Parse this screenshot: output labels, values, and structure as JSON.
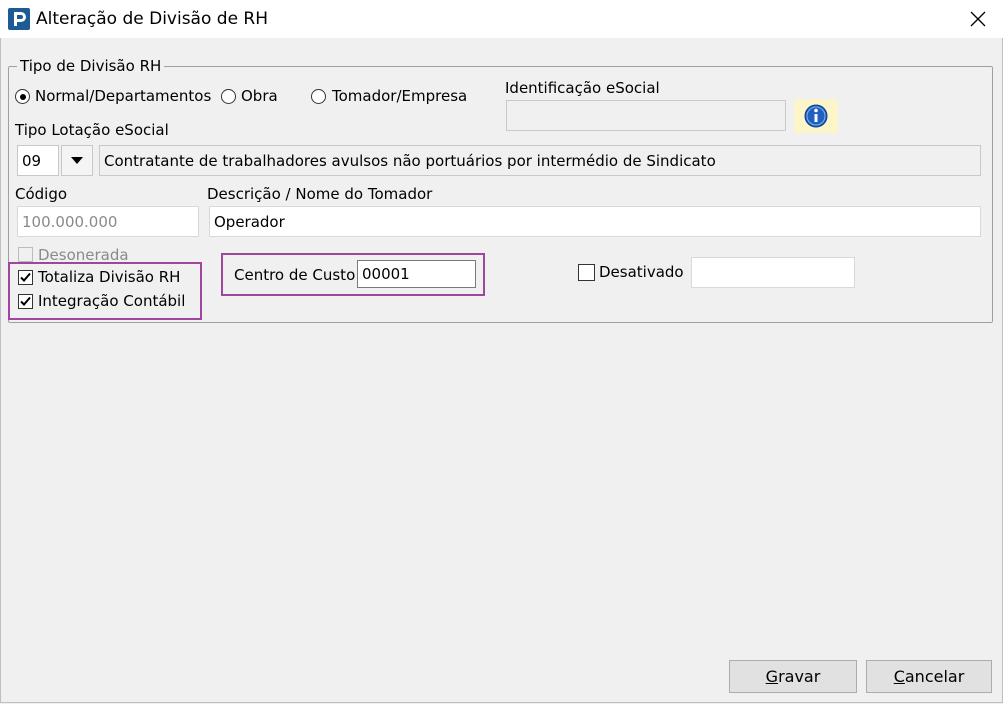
{
  "window": {
    "title": "Alteração de Divisão de RH"
  },
  "group": {
    "legend": "Tipo de Divisão RH",
    "radios": [
      {
        "label": "Normal/Departamentos",
        "checked": true
      },
      {
        "label": "Obra",
        "checked": false
      },
      {
        "label": "Tomador/Empresa",
        "checked": false
      }
    ]
  },
  "identificacao": {
    "label": "Identificação eSocial",
    "value": ""
  },
  "tipo_lotacao": {
    "label": "Tipo Lotação eSocial",
    "code": "09",
    "description": "Contratante de trabalhadores avulsos não portuários por intermédio de Sindicato"
  },
  "codigo": {
    "label": "Código",
    "value": "100.000.000"
  },
  "descricao": {
    "label": "Descrição / Nome do Tomador",
    "value": "Operador"
  },
  "checkboxes": {
    "desonerada": {
      "label": "Desonerada",
      "checked": false,
      "enabled": false
    },
    "totaliza": {
      "label": "Totaliza Divisão RH",
      "checked": true
    },
    "integracao": {
      "label": "Integração Contábil",
      "checked": true
    },
    "desativado": {
      "label": "Desativado",
      "checked": false
    }
  },
  "centro_custo": {
    "label": "Centro de Custo",
    "value": "00001"
  },
  "desativado_field": {
    "value": ""
  },
  "buttons": {
    "gravar": {
      "accel": "G",
      "rest": "ravar"
    },
    "cancelar": {
      "accel": "C",
      "rest": "ancelar"
    }
  },
  "colors": {
    "highlight": "#a046a0",
    "info": "#1f5fbf"
  }
}
